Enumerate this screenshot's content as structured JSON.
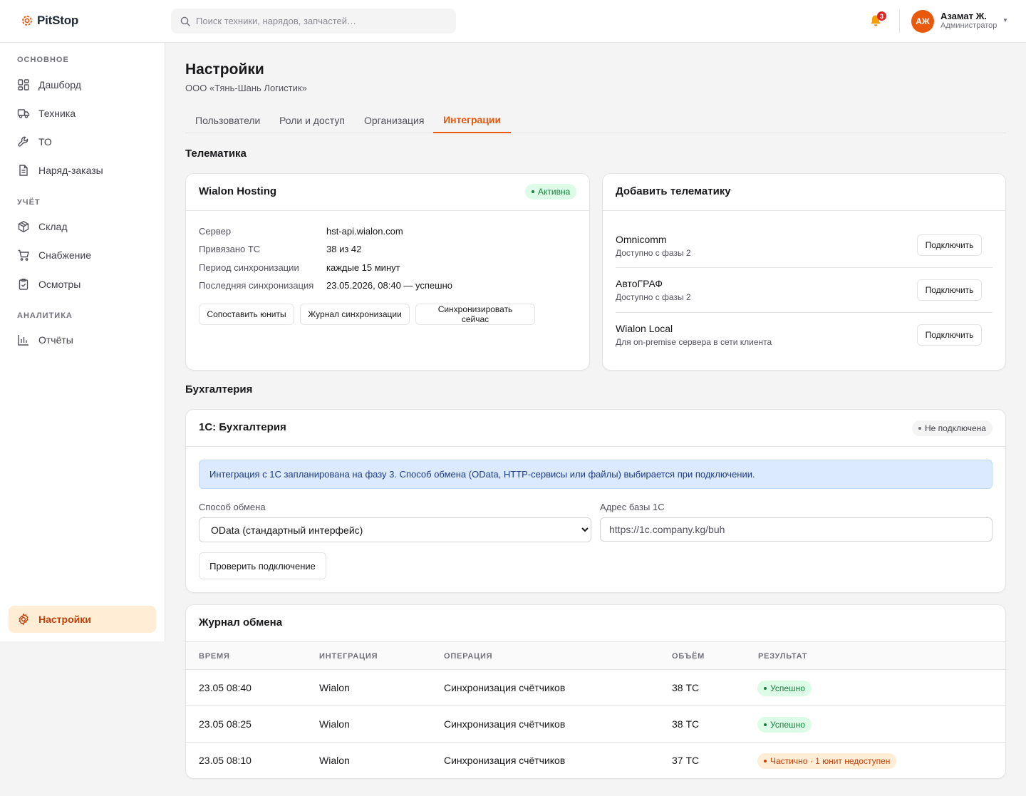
{
  "app": {
    "name": "PitStop"
  },
  "search": {
    "placeholder": "Поиск техники, нарядов, запчастей…"
  },
  "header": {
    "notifications_count": "3",
    "user": {
      "initials": "АЖ",
      "name": "Азамат Ж.",
      "role": "Администратор"
    }
  },
  "sidebar": {
    "sections": [
      {
        "title": "ОСНОВНОЕ"
      },
      {
        "title": "УЧЁТ"
      },
      {
        "title": "АНАЛИТИКА"
      }
    ],
    "items": [
      {
        "label": "Дашборд",
        "icon": "dashboard-icon"
      },
      {
        "label": "Техника",
        "icon": "truck-icon"
      },
      {
        "label": "ТО",
        "icon": "wrench-icon"
      },
      {
        "label": "Наряд-заказы",
        "icon": "document-icon"
      },
      {
        "label": "Склад",
        "icon": "box-icon"
      },
      {
        "label": "Снабжение",
        "icon": "cart-icon"
      },
      {
        "label": "Осмотры",
        "icon": "clipboard-icon"
      },
      {
        "label": "Отчёты",
        "icon": "bar-chart-icon"
      }
    ],
    "settings": {
      "label": "Настройки",
      "icon": "gear-icon"
    }
  },
  "page": {
    "title": "Настройки",
    "subtitle": "ООО «Тянь-Шань Логистик»",
    "tabs": [
      {
        "label": "Пользователи",
        "active": false
      },
      {
        "label": "Роли и доступ",
        "active": false
      },
      {
        "label": "Организация",
        "active": false
      },
      {
        "label": "Интеграции",
        "active": true
      }
    ]
  },
  "telematics": {
    "section_title": "Телематика",
    "wialon": {
      "title": "Wialon Hosting",
      "status": "Активна",
      "fields": [
        {
          "label": "Сервер",
          "value": "hst-api.wialon.com"
        },
        {
          "label": "Привязано ТС",
          "value": "38 из 42"
        },
        {
          "label": "Период синхронизации",
          "value": "каждые 15 минут"
        },
        {
          "label": "Последняя синхронизация",
          "value": "23.05.2026, 08:40 — успешно"
        }
      ],
      "buttons": [
        {
          "label": "Сопоставить юниты"
        },
        {
          "label": "Журнал синхронизации"
        },
        {
          "label": "Синхронизировать сейчас"
        }
      ]
    },
    "add": {
      "title": "Добавить телематику",
      "providers": [
        {
          "name": "Omnicomm",
          "note": "Доступно с фазы 2",
          "button": "Подключить"
        },
        {
          "name": "АвтоГРАФ",
          "note": "Доступно с фазы 2",
          "button": "Подключить"
        },
        {
          "name": "Wialon Local",
          "note": "Для on-premise сервера в сети клиента",
          "button": "Подключить"
        }
      ]
    }
  },
  "accounting": {
    "section_title": "Бухгалтерия",
    "card": {
      "title": "1С: Бухгалтерия",
      "status": "Не подключена",
      "info": "Интеграция с 1С запланирована на фазу 3. Способ обмена (OData, HTTP-сервисы или файлы) выбирается при подключении.",
      "method_label": "Способ обмена",
      "method_value": "OData (стандартный интерфейс)",
      "address_label": "Адрес базы 1С",
      "address_placeholder": "https://1c.company.kg/buh",
      "check_button": "Проверить подключение"
    }
  },
  "log": {
    "title": "Журнал обмена",
    "columns": [
      "ВРЕМЯ",
      "ИНТЕГРАЦИЯ",
      "ОПЕРАЦИЯ",
      "ОБЪЁМ",
      "РЕЗУЛЬТАТ"
    ],
    "rows": [
      {
        "time": "23.05 08:40",
        "integration": "Wialon",
        "operation": "Синхронизация счётчиков",
        "volume": "38 ТС",
        "result": "Успешно",
        "status": "success"
      },
      {
        "time": "23.05 08:25",
        "integration": "Wialon",
        "operation": "Синхронизация счётчиков",
        "volume": "38 ТС",
        "result": "Успешно",
        "status": "success"
      },
      {
        "time": "23.05 08:10",
        "integration": "Wialon",
        "operation": "Синхронизация счётчиков",
        "volume": "37 ТС",
        "result": "Частично · 1 юнит недоступен",
        "status": "partial"
      }
    ]
  },
  "colors": {
    "accent": "#ea580c",
    "success": "#15803d",
    "warning": "#c2410c",
    "info_bg": "#dbeafe"
  }
}
